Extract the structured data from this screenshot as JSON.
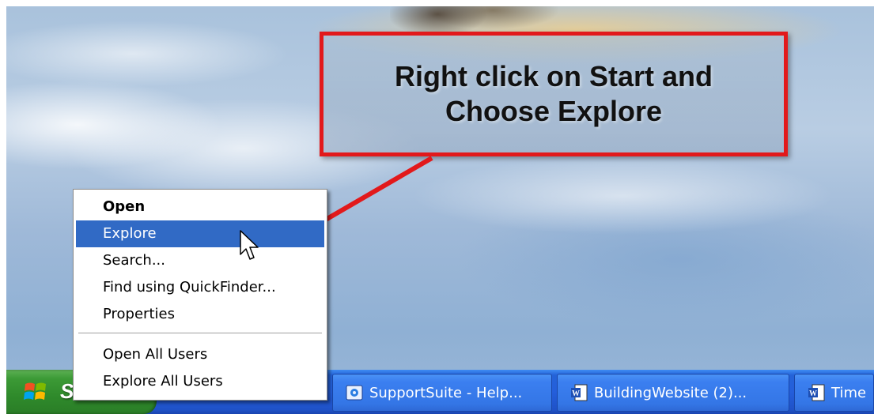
{
  "callout": {
    "line1": "Right click on Start and",
    "line2": "Choose Explore",
    "border_color": "#e2191b"
  },
  "context_menu": {
    "items": [
      {
        "label": "Open",
        "bold": true
      },
      {
        "label": "Explore",
        "highlighted": true
      },
      {
        "label": "Search..."
      },
      {
        "label": "Find using QuickFinder..."
      },
      {
        "label": "Properties"
      },
      {
        "label": "Open All Users"
      },
      {
        "label": "Explore All Users"
      }
    ],
    "highlight_color": "#316ac5"
  },
  "taskbar": {
    "start_label": "Start",
    "buttons": [
      {
        "label": "SupportSuite - Help...",
        "icon": "browser-icon"
      },
      {
        "label": "BuildingWebsite (2)...",
        "icon": "word-document-icon"
      },
      {
        "label": "Time",
        "icon": "word-document-icon"
      }
    ]
  }
}
